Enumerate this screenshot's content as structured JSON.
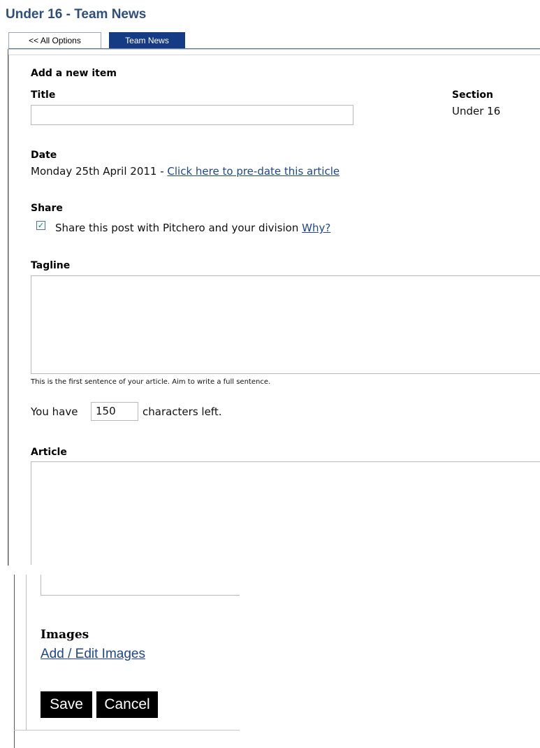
{
  "page": {
    "title": "Under 16 - Team News"
  },
  "tabs": [
    {
      "label": "<< All Options"
    },
    {
      "label": "Team News"
    }
  ],
  "form": {
    "heading": "Add a new item",
    "title": {
      "label": "Title",
      "value": ""
    },
    "section": {
      "label": "Section",
      "value": "Under 16"
    },
    "date": {
      "label": "Date",
      "value": "Monday 25th April 2011 - ",
      "link": "Click here to pre-date this article"
    },
    "share": {
      "label": "Share",
      "checked": true,
      "text": "Share this post with Pitchero and your division ",
      "why_link": "Why?"
    },
    "tagline": {
      "label": "Tagline",
      "value": "",
      "hint": "This is the first sentence of your article. Aim to write a full sentence."
    },
    "counter": {
      "prefix": "You have",
      "value": "150",
      "suffix": "characters left."
    },
    "article": {
      "label": "Article",
      "value": ""
    },
    "images": {
      "label": "Images",
      "link": "Add / Edit Images"
    },
    "buttons": {
      "save": "Save",
      "cancel": "Cancel"
    }
  },
  "colors": {
    "title": "#2e4f7c",
    "active_tab": "#163b85",
    "link": "#1d4690",
    "check": "#1a8a2a"
  }
}
